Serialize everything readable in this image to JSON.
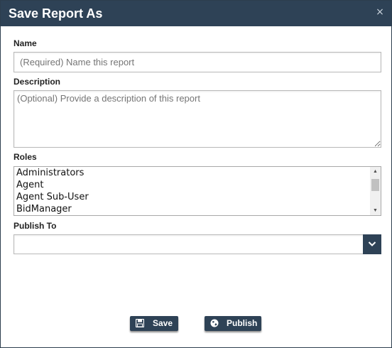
{
  "dialog": {
    "title": "Save Report As",
    "close_glyph": "×"
  },
  "form": {
    "name_label": "Name",
    "name_placeholder": "(Required) Name this report",
    "name_value": "",
    "description_label": "Description",
    "description_placeholder": "(Optional) Provide a description of this report",
    "description_value": "",
    "roles_label": "Roles",
    "roles": [
      "Administrators",
      "Agent",
      "Agent Sub-User",
      "BidManager"
    ],
    "publish_label": "Publish To",
    "publish_value": ""
  },
  "buttons": {
    "save_label": "Save",
    "save_icon": "floppy-disk-icon",
    "publish_label": "Publish",
    "publish_icon": "globe-icon"
  },
  "colors": {
    "titlebar": "#2e4256",
    "button": "#2e4256",
    "button_text": "#ffffff"
  }
}
